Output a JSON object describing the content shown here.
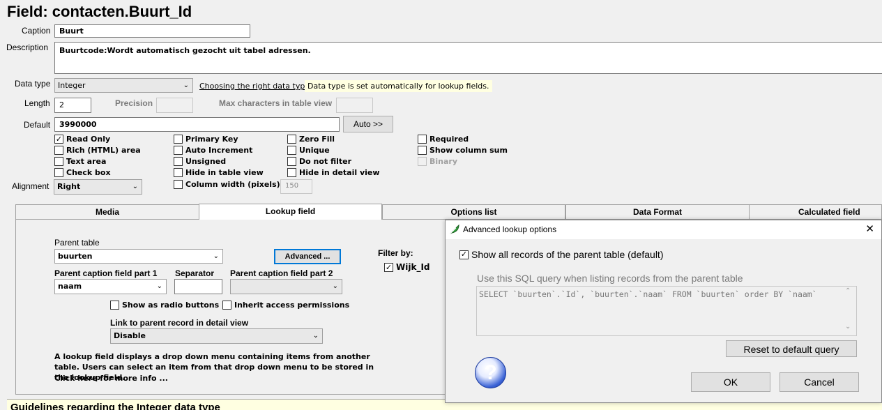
{
  "page": {
    "title": "Field: contacten.Buurt_Id"
  },
  "form": {
    "caption_label": "Caption",
    "caption_value": "Buurt",
    "description_label": "Description",
    "description_value": "Buurtcode:Wordt automatisch gezocht uit tabel adressen.",
    "datatype_label": "Data type",
    "datatype_value": "Integer",
    "datatype_link": "Choosing the right data type",
    "datatype_tip": "Data type is set automatically for lookup fields.",
    "length_label": "Length",
    "length_value": "2",
    "precision_label": "Precision",
    "maxchars_label": "Max characters in table view",
    "default_label": "Default",
    "default_value": "3990000",
    "auto_button": "Auto >>",
    "alignment_label": "Alignment",
    "alignment_value": "Right",
    "colwidth_label": "Column width (pixels)",
    "colwidth_value": "150"
  },
  "checkboxes": {
    "read_only": {
      "label": "Read Only",
      "checked": "✓"
    },
    "rich_html": {
      "label": "Rich (HTML) area",
      "checked": ""
    },
    "text_area": {
      "label": "Text area",
      "checked": ""
    },
    "check_box": {
      "label": "Check box",
      "checked": ""
    },
    "primary_key": {
      "label": "Primary Key",
      "checked": ""
    },
    "auto_increment": {
      "label": "Auto Increment",
      "checked": ""
    },
    "unsigned": {
      "label": "Unsigned",
      "checked": ""
    },
    "hide_table": {
      "label": "Hide in table view",
      "checked": ""
    },
    "column_width": {
      "label": "Column width (pixels)",
      "checked": ""
    },
    "zero_fill": {
      "label": "Zero Fill",
      "checked": ""
    },
    "unique": {
      "label": "Unique",
      "checked": ""
    },
    "do_not_filter": {
      "label": "Do not filter",
      "checked": ""
    },
    "hide_detail": {
      "label": "Hide in detail view",
      "checked": ""
    },
    "required": {
      "label": "Required",
      "checked": ""
    },
    "show_sum": {
      "label": "Show column sum",
      "checked": ""
    },
    "binary": {
      "label": "Binary",
      "checked": ""
    }
  },
  "tabs": [
    {
      "label": "Media"
    },
    {
      "label": "Lookup field"
    },
    {
      "label": "Options list"
    },
    {
      "label": "Data Format"
    },
    {
      "label": "Calculated field"
    }
  ],
  "lookup": {
    "parent_table_label": "Parent table",
    "parent_table_value": "buurten",
    "advanced_button": "Advanced ...",
    "filter_label": "Filter by:",
    "filter_item": "Wijk_Id",
    "filter_checked": "✓",
    "caption1_label": "Parent caption field part 1",
    "caption1_value": "naam",
    "separator_label": "Separator",
    "separator_value": "",
    "caption2_label": "Parent caption field part 2",
    "caption2_value": "",
    "radio_label": "Show as radio buttons",
    "inherit_label": "Inherit access permissions",
    "link_label": "Link to parent record in detail view",
    "link_value": "Disable",
    "description": "A lookup field displays a drop down menu containing items from another table. Users can select an item from that drop down menu to be stored in the lookup field.",
    "more_info": "Click here for more info ..."
  },
  "footer": {
    "guidelines": "Guidelines regarding the Integer data type"
  },
  "dialog": {
    "title": "Advanced lookup options",
    "close": "✕",
    "show_all_label": "Show all records of the parent table (default)",
    "show_all_checked": "✓",
    "sql_label": "Use this SQL query when listing records from the parent table",
    "sql_value": "SELECT `buurten`.`Id`, `buurten`.`naam` FROM `buurten` order BY `naam`",
    "reset_button": "Reset to default query",
    "ok_button": "OK",
    "cancel_button": "Cancel",
    "help_icon": "?"
  },
  "colors": {
    "tip_bg": "#ffffe1",
    "focus_border": "#0078d7",
    "help_icon": "#2b55c8"
  }
}
